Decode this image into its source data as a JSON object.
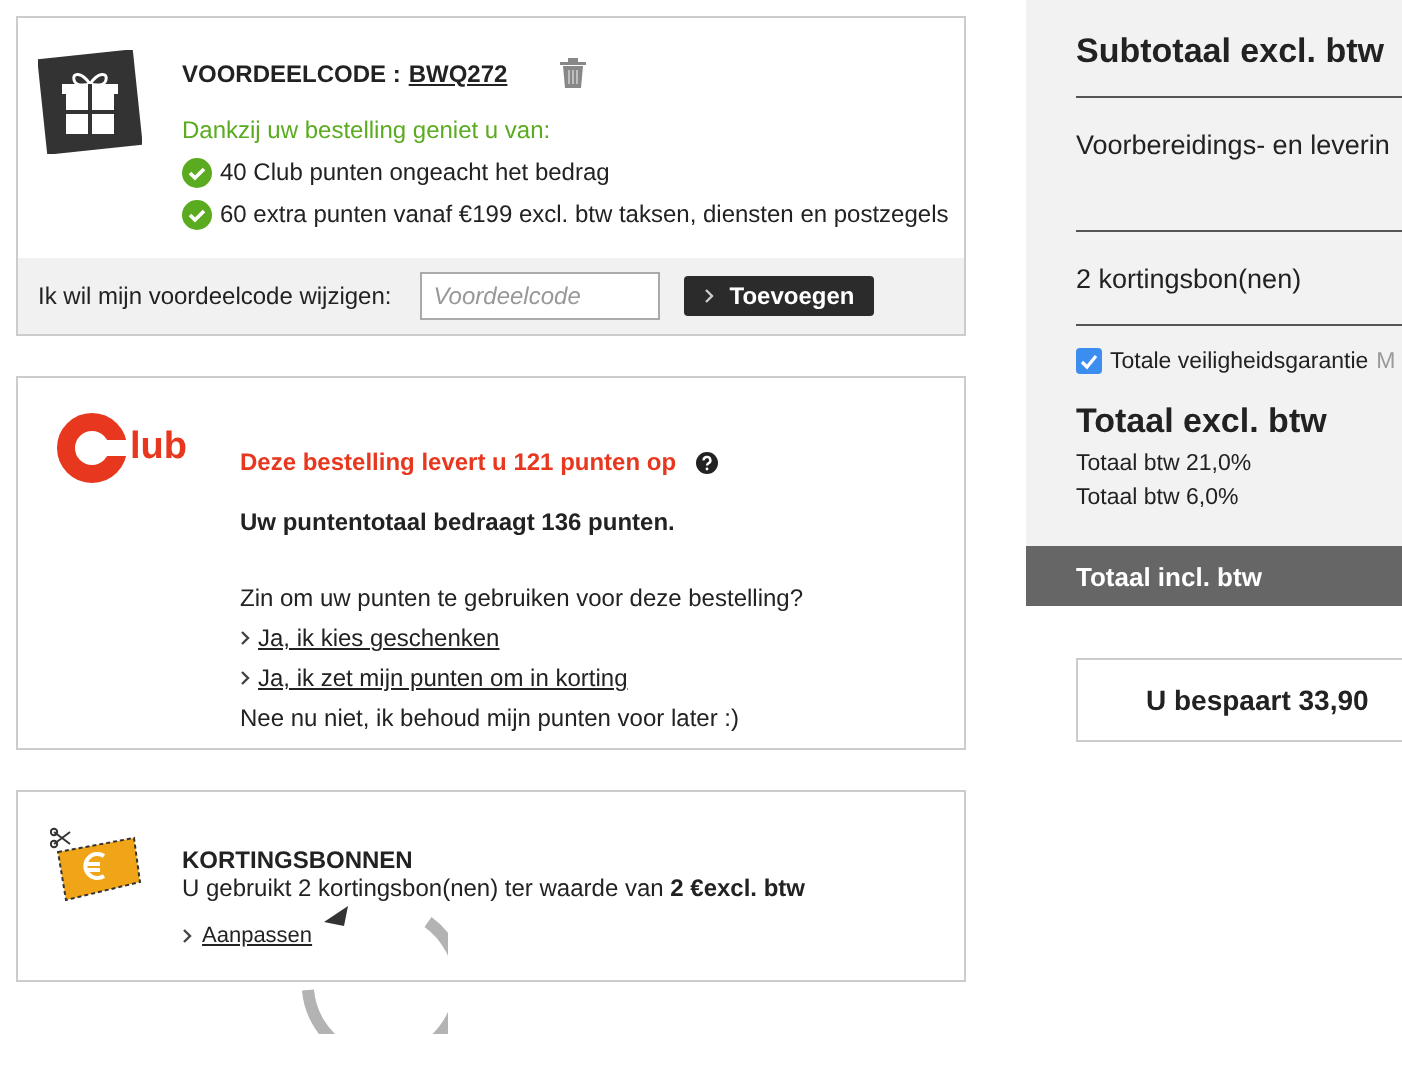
{
  "promo": {
    "label": "VOORDEELCODE :",
    "code": "BWQ272",
    "intro": "Dankzij uw bestelling geniet u van:",
    "benefits": [
      "40 Club punten ongeacht het bedrag",
      "60 extra punten vanaf €199 excl. btw taksen, diensten en postzegels"
    ],
    "change_label": "Ik wil mijn voordeelcode wijzigen:",
    "placeholder": "Voordeelcode",
    "button": "Toevoegen"
  },
  "club": {
    "logo_text": "lub",
    "earn": "Deze bestelling levert u 121 punten op",
    "total": "Uw puntentotaal bedraagt 136 punten.",
    "question": "Zin om uw punten te gebruiken voor deze bestelling?",
    "options": [
      "Ja, ik kies geschenken",
      "Ja, ik zet mijn punten om in korting"
    ],
    "decline": "Nee nu niet, ik behoud mijn punten voor later :)"
  },
  "coupons": {
    "title": "KORTINGSBONNEN",
    "text": "U gebruikt 2 kortingsbon(nen) ter waarde van **2 €excl. btw**",
    "link": "Aanpassen"
  },
  "summary": {
    "subtotal": "Subtotaal excl. btw",
    "shipping": "Voorbereidings- en leverin",
    "coupons": "2 kortingsbon(nen)",
    "guarantee": {
      "label": "Totale veiligheidsgarantie",
      "note": "M",
      "checked": true
    },
    "total_excl": "Totaal excl. btw",
    "vat": [
      "Totaal btw 21,0%",
      "Totaal btw 6,0%"
    ],
    "total_incl": "Totaal incl. btw",
    "savings": "U bespaart 33,90"
  }
}
